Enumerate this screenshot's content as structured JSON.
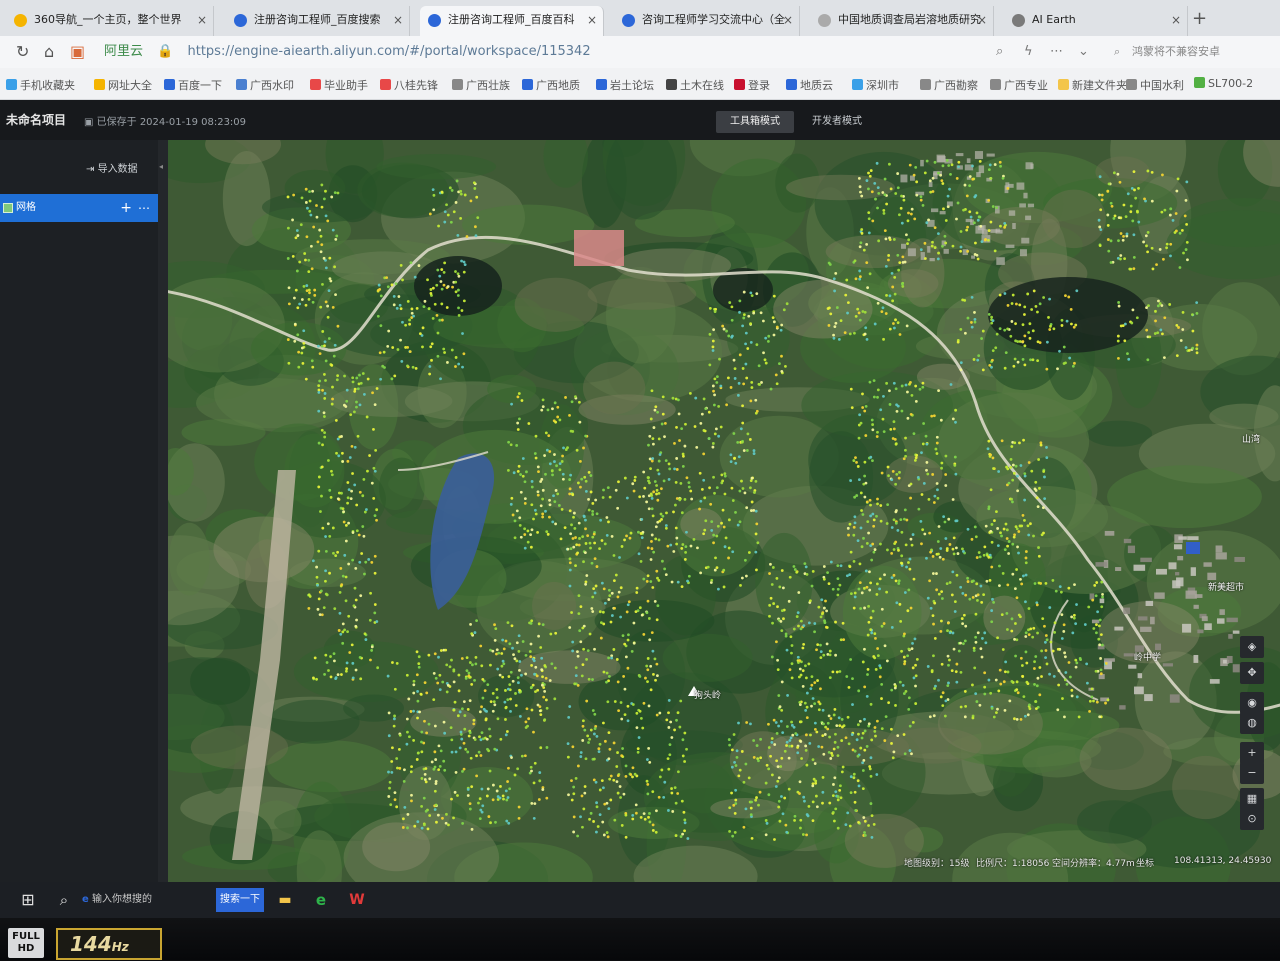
{
  "browser": {
    "tabs": [
      {
        "title": "360导航_一个主页，整个世界",
        "icon_color": "#f5b400",
        "active": false
      },
      {
        "title": "注册咨询工程师_百度搜索",
        "icon_color": "#2c67d8",
        "active": false
      },
      {
        "title": "注册咨询工程师_百度百科",
        "icon_color": "#2c67d8",
        "active": true
      },
      {
        "title": "咨询工程师学习交流中心（全",
        "icon_color": "#2c67d8",
        "active": false
      },
      {
        "title": "中国地质调查局岩溶地质研究",
        "icon_color": "#aaaaaa",
        "active": false
      },
      {
        "title": "AI Earth",
        "icon_color": "#7a7a7a",
        "active": false
      }
    ],
    "tab_close": "×",
    "new_tab": "+",
    "address": {
      "site_label": "阿里云",
      "url": "https://engine-aiearth.aliyun.com/#/portal/workspace/115342"
    },
    "search_placeholder": "鸿蒙将不兼容安卓",
    "nav": {
      "back": "←",
      "home": "⌂"
    },
    "bookmarks": [
      {
        "label": "手机收藏夹",
        "icon_color": "#3aa0e8"
      },
      {
        "label": "网址大全",
        "icon_color": "#f5b400"
      },
      {
        "label": "百度一下",
        "icon_color": "#2c67d8"
      },
      {
        "label": "广西水印",
        "icon_color": "#4a7fd0"
      },
      {
        "label": "毕业助手",
        "icon_color": "#e84848"
      },
      {
        "label": "八桂先锋",
        "icon_color": "#e84848"
      },
      {
        "label": "广西壮族",
        "icon_color": "#888888"
      },
      {
        "label": "广西地质",
        "icon_color": "#2c67d8"
      },
      {
        "label": "岩土论坛",
        "icon_color": "#2c67d8"
      },
      {
        "label": "土木在线",
        "icon_color": "#444444"
      },
      {
        "label": "登录",
        "icon_color": "#c8102e"
      },
      {
        "label": "地质云",
        "icon_color": "#2c67d8"
      },
      {
        "label": "深圳市",
        "icon_color": "#3aa0e8"
      },
      {
        "label": "广西勘察",
        "icon_color": "#888888"
      },
      {
        "label": "广西专业",
        "icon_color": "#888888"
      },
      {
        "label": "新建文件夹",
        "icon_color": "#f3c54a"
      },
      {
        "label": "中国水利",
        "icon_color": "#888888"
      },
      {
        "label": "SL700-2",
        "icon_color": "#52b043"
      }
    ]
  },
  "app": {
    "project_title": "未命名项目",
    "saved_status": "已保存于 2024-01-19 08:23:09",
    "modes": {
      "tools": "工具箱模式",
      "developer": "开发者模式"
    },
    "sidebar": {
      "import_label": "导入数据",
      "layer_name": "网格",
      "add": "+",
      "more": "⋯"
    },
    "map": {
      "labels": [
        {
          "text": "山湾"
        },
        {
          "text": "新美超市"
        },
        {
          "text": "岭中学"
        },
        {
          "text": "狗头岭"
        }
      ],
      "status": {
        "zoom": "地图级别：15级",
        "scale": "比例尺：1:18056",
        "resolution": "空间分辨率：4.77m",
        "coord_label": "坐标",
        "coords": "108.41313, 24.45930"
      },
      "controls": [
        {
          "name": "compass",
          "glyph": "◈"
        },
        {
          "name": "pan",
          "glyph": "✥"
        },
        {
          "name": "locate",
          "glyph": "◉"
        },
        {
          "name": "globe",
          "glyph": "◍"
        },
        {
          "name": "zoom-in",
          "glyph": "+"
        },
        {
          "name": "zoom-out",
          "glyph": "−"
        },
        {
          "name": "layers",
          "glyph": "▦"
        },
        {
          "name": "measure",
          "glyph": "⊙"
        }
      ]
    }
  },
  "taskbar": {
    "search_text": "输入你想搜的",
    "baidu_button": "搜索一下"
  },
  "monitor": {
    "badge_hd": "FULL HD",
    "badge_hz": "144",
    "badge_hz_unit": "Hz"
  }
}
